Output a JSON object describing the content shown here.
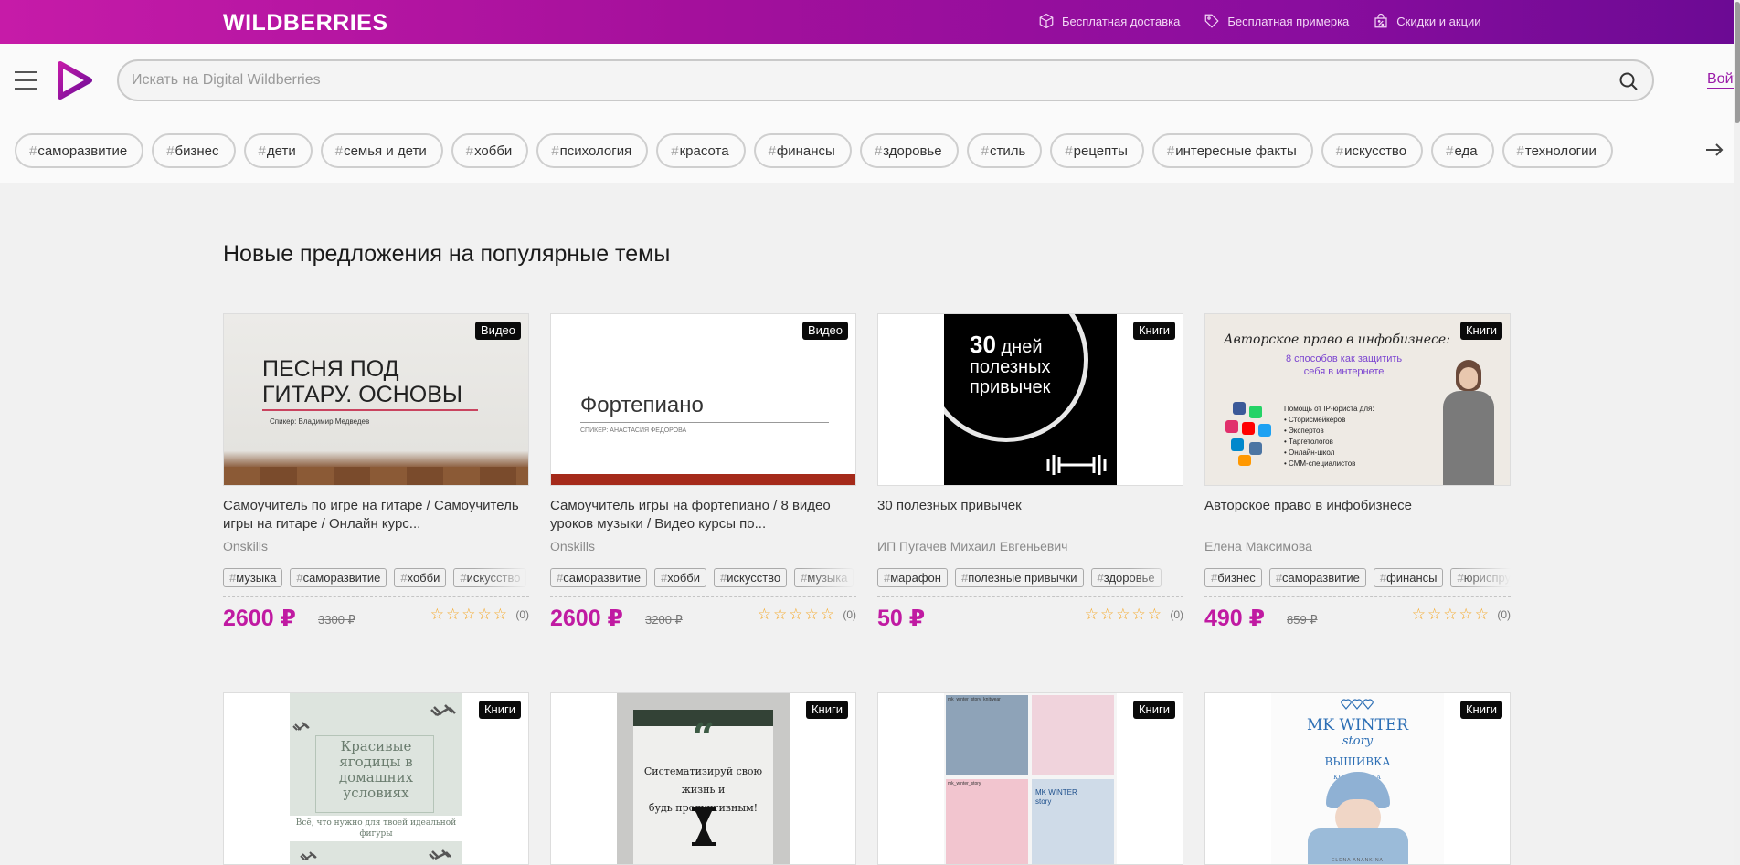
{
  "topbar": {
    "brand": "WILDBERRIES",
    "links": [
      {
        "label": "Бесплатная доставка",
        "icon": "box-icon"
      },
      {
        "label": "Бесплатная примерка",
        "icon": "tag-icon"
      },
      {
        "label": "Скидки и акции",
        "icon": "discount-bag-icon"
      }
    ]
  },
  "header": {
    "search_placeholder": "Искать на Digital Wildberries",
    "login_label": "Войти"
  },
  "tags": [
    "саморазвитие",
    "бизнес",
    "дети",
    "семья и дети",
    "хобби",
    "психология",
    "красота",
    "финансы",
    "здоровье",
    "стиль",
    "рецепты",
    "интересные факты",
    "искусство",
    "еда",
    "технологии"
  ],
  "section": {
    "title": "Новые предложения на популярные темы"
  },
  "cards": [
    {
      "badge": "Видео",
      "title": "Самоучитель по игре на гитаре / Самоучитель игры на гитаре / Онлайн курс...",
      "author": "Onskills",
      "tags": [
        "музыка",
        "саморазвитие",
        "хобби",
        "искусство"
      ],
      "price": "2600 ₽",
      "old_price": "3300 ₽",
      "rating_count": "(0)",
      "image": {
        "line1": "ПЕСНЯ ПОД",
        "line2": "ГИТАРУ. ОСНОВЫ",
        "caption": "Спикер: Владимир Медведев"
      }
    },
    {
      "badge": "Видео",
      "title": "Самоучитель игры на фортепиано / 8 видео уроков музыки / Видео курсы по...",
      "author": "Onskills",
      "tags": [
        "саморазвитие",
        "хобби",
        "искусство",
        "музыка"
      ],
      "price": "2600 ₽",
      "old_price": "3200 ₽",
      "rating_count": "(0)",
      "image": {
        "line1": "Фортепиано",
        "caption": "СПИКЕР: АНАСТАСИЯ ФЁДОРОВА"
      }
    },
    {
      "badge": "Книги",
      "title": "30 полезных привычек",
      "author": "ИП Пугачев Михаил Евгеньевич",
      "tags": [
        "марафон",
        "полезные привычки",
        "здоровье"
      ],
      "price": "50 ₽",
      "old_price": "",
      "rating_count": "(0)",
      "image": {
        "num": "30",
        "word1": "дней",
        "line2": "полезных",
        "line3": "привычек"
      }
    },
    {
      "badge": "Книги",
      "title": "Авторское право в инфобизнесе",
      "author": "Елена Максимова",
      "tags": [
        "бизнес",
        "саморазвитие",
        "финансы",
        "юриспруденция"
      ],
      "price": "490 ₽",
      "old_price": "859 ₽",
      "rating_count": "(0)",
      "image": {
        "title": "Авторское право в инфобизнесе:",
        "subtitle1": "8 способов как защитить",
        "subtitle2": "себя в интернете",
        "help": "Помощь от IP-юриста для:",
        "bullets": [
          "Сторисмейкеров",
          "Экспертов",
          "Таргетологов",
          "Онлайн-школ",
          "СММ-специалистов"
        ]
      }
    }
  ],
  "cards_row2": [
    {
      "badge": "Книги",
      "image": {
        "line1": "Красивые",
        "line2": "ягодицы в",
        "line3": "домашних",
        "line4": "условиях",
        "caption1": "Всё, что нужно для твоей идеальной",
        "caption2": "фигуры"
      }
    },
    {
      "badge": "Книги",
      "image": {
        "quote": "“",
        "line1": "Систематизируй свою жизнь и",
        "line2": "будь продуктивным!"
      }
    },
    {
      "badge": "Книги",
      "image": {
        "label1": "mk_winter_story_knitwear",
        "label2": "mk_winter_story",
        "label3": "MK WINTER",
        "label4": "story"
      }
    },
    {
      "badge": "Книги",
      "image": {
        "line1": "MK WINTER",
        "line2": "story",
        "line3": "ВЫШИВКА",
        "line4": "КОМПЛЕКТА",
        "author": "ELENA ANANKINA"
      }
    }
  ],
  "colors": {
    "brand_gradient_start": "#c61ba8",
    "brand_gradient_end": "#6c0a94",
    "price": "#c01aa2",
    "star": "#f5a623"
  }
}
